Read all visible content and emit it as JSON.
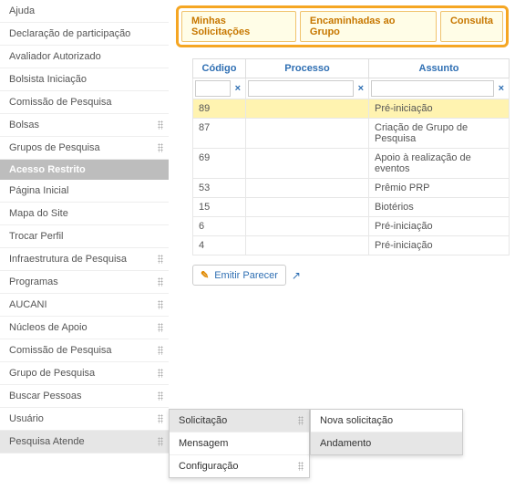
{
  "sidebar": {
    "group1": [
      {
        "label": "Ajuda",
        "exp": false
      },
      {
        "label": "Declaração de participação",
        "exp": false
      },
      {
        "label": "Avaliador Autorizado",
        "exp": false
      },
      {
        "label": "Bolsista Iniciação",
        "exp": false
      },
      {
        "label": "Comissão de Pesquisa",
        "exp": false
      },
      {
        "label": "Bolsas",
        "exp": true
      },
      {
        "label": "Grupos de Pesquisa",
        "exp": true
      }
    ],
    "section_title": "Acesso Restrito",
    "group2": [
      {
        "label": "Página Inicial",
        "exp": false
      },
      {
        "label": "Mapa do Site",
        "exp": false
      },
      {
        "label": "Trocar Perfil",
        "exp": false
      },
      {
        "label": "Infraestrutura de Pesquisa",
        "exp": true
      },
      {
        "label": "Programas",
        "exp": true
      },
      {
        "label": "AUCANI",
        "exp": true
      },
      {
        "label": "Núcleos de Apoio",
        "exp": true
      },
      {
        "label": "Comissão de Pesquisa",
        "exp": true
      },
      {
        "label": "Grupo de Pesquisa",
        "exp": true
      },
      {
        "label": "Buscar Pessoas",
        "exp": true
      },
      {
        "label": "Usuário",
        "exp": true
      },
      {
        "label": "Pesquisa Atende",
        "exp": true,
        "active": true
      }
    ]
  },
  "tabs": [
    {
      "label": "Minhas Solicitações"
    },
    {
      "label": "Encaminhadas ao Grupo"
    },
    {
      "label": "Consulta"
    }
  ],
  "grid": {
    "headers": {
      "codigo": "Código",
      "processo": "Processo",
      "assunto": "Assunto"
    },
    "rows": [
      {
        "codigo": "89",
        "processo": "",
        "assunto": "Pré-iniciação",
        "sel": true
      },
      {
        "codigo": "87",
        "processo": "",
        "assunto": "Criação de Grupo de Pesquisa"
      },
      {
        "codigo": "69",
        "processo": "",
        "assunto": "Apoio à realização de eventos"
      },
      {
        "codigo": "53",
        "processo": "",
        "assunto": "Prêmio PRP"
      },
      {
        "codigo": "15",
        "processo": "",
        "assunto": "Biotérios"
      },
      {
        "codigo": "6",
        "processo": "",
        "assunto": "Pré-iniciação"
      },
      {
        "codigo": "4",
        "processo": "",
        "assunto": "Pré-iniciação"
      }
    ]
  },
  "buttons": {
    "emitir": "Emitir Parecer"
  },
  "flyout1": [
    {
      "label": "Solicitação",
      "exp": true,
      "hover": true
    },
    {
      "label": "Mensagem",
      "exp": false
    },
    {
      "label": "Configuração",
      "exp": true
    }
  ],
  "flyout2": [
    {
      "label": "Nova solicitação",
      "hover": false
    },
    {
      "label": "Andamento",
      "hover": true
    }
  ]
}
